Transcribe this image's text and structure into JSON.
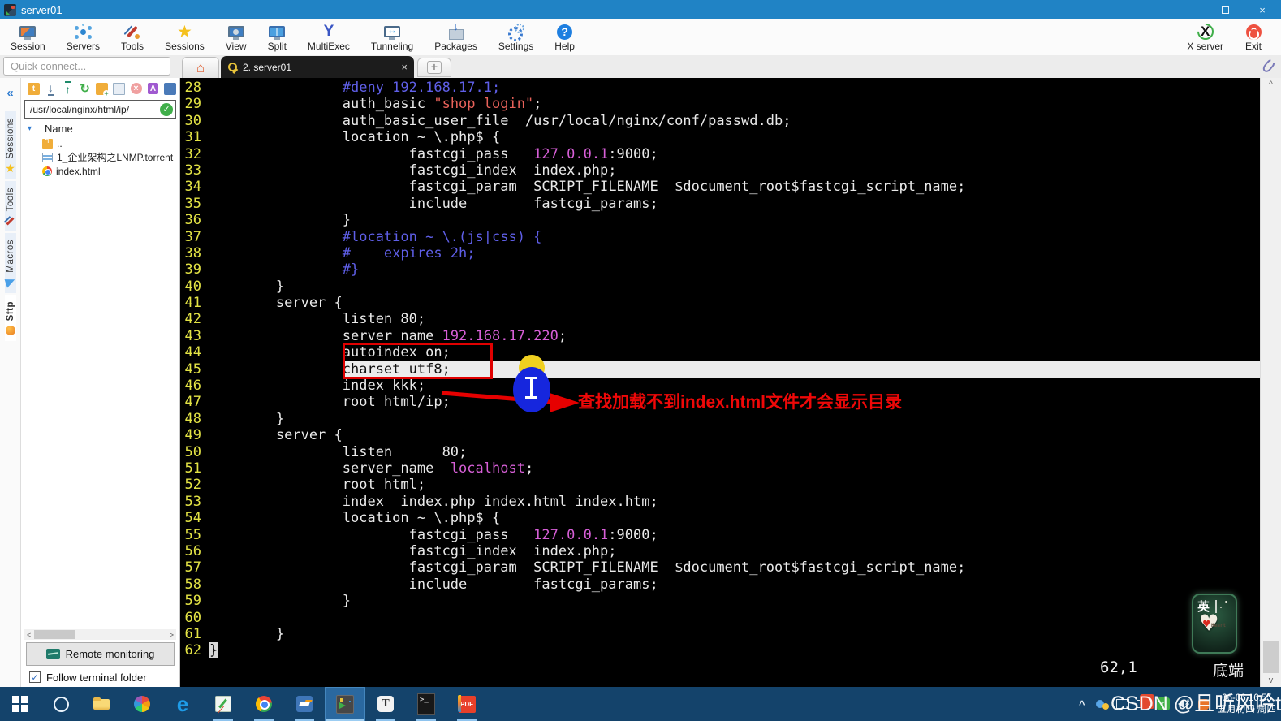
{
  "window": {
    "title": "server01"
  },
  "toolbar": {
    "buttons": [
      {
        "label": "Session",
        "icon": "session-icon"
      },
      {
        "label": "Servers",
        "icon": "servers-icon"
      },
      {
        "label": "Tools",
        "icon": "tools-icon"
      },
      {
        "label": "Sessions",
        "icon": "sessions-star-icon"
      },
      {
        "label": "View",
        "icon": "view-icon"
      },
      {
        "label": "Split",
        "icon": "split-icon"
      },
      {
        "label": "MultiExec",
        "icon": "multiexec-icon"
      },
      {
        "label": "Tunneling",
        "icon": "tunneling-icon"
      },
      {
        "label": "Packages",
        "icon": "packages-icon"
      },
      {
        "label": "Settings",
        "icon": "settings-icon"
      },
      {
        "label": "Help",
        "icon": "help-icon"
      }
    ],
    "right_buttons": [
      {
        "label": "X server",
        "icon": "xserver-icon"
      },
      {
        "label": "Exit",
        "icon": "exit-icon"
      }
    ]
  },
  "quick_connect": {
    "placeholder": "Quick connect..."
  },
  "tabs": {
    "active_label": "2. server01",
    "close_glyph": "×"
  },
  "sidebar": {
    "tabs": [
      {
        "label": "Sessions",
        "icon": "star-icon",
        "active": false
      },
      {
        "label": "Tools",
        "icon": "vtools-icon",
        "active": false
      },
      {
        "label": "Macros",
        "icon": "macro-plane-icon",
        "active": false
      },
      {
        "label": "Sftp",
        "icon": "sftp-ball-icon",
        "active": true
      }
    ],
    "sftp_icons": [
      "folder-up-icon",
      "download-icon",
      "upload-icon",
      "refresh-icon",
      "new-folder-icon",
      "new-file-icon",
      "delete-icon",
      "rename-icon",
      "sync-icon"
    ],
    "path": "/usr/local/nginx/html/ip/",
    "name_header": "Name",
    "files": [
      {
        "name": "..",
        "icon": "folder-up"
      },
      {
        "name": "1_企业架构之LNMP.torrent",
        "icon": "torrent-file"
      },
      {
        "name": "index.html",
        "icon": "chrome-file"
      }
    ],
    "remote_monitoring_label": "Remote monitoring",
    "follow_label": "Follow terminal folder"
  },
  "terminal": {
    "colors": {
      "comment": "#5f5fe8",
      "string": "#e8625a",
      "ip": "#d75fd7",
      "line_number": "#e3e345"
    },
    "highlight_line": 45,
    "boxed_lines": [
      44,
      45
    ],
    "annotation": "查找加载不到index.html文件才会显示目录",
    "status": {
      "position": "62,1",
      "scroll": "底端"
    },
    "lines": [
      {
        "n": 28,
        "s": [
          {
            "t": "                #deny 192.168.17.1;",
            "c": "comment"
          }
        ]
      },
      {
        "n": 29,
        "s": [
          {
            "t": "                auth_basic ",
            "c": "code"
          },
          {
            "t": "\"shop login\"",
            "c": "string"
          },
          {
            "t": ";",
            "c": "code"
          }
        ]
      },
      {
        "n": 30,
        "s": [
          {
            "t": "                auth_basic_user_file  /usr/local/nginx/conf/passwd.db;",
            "c": "code"
          }
        ]
      },
      {
        "n": 31,
        "s": [
          {
            "t": "                location ~ \\.php$ {",
            "c": "code"
          }
        ]
      },
      {
        "n": 32,
        "s": [
          {
            "t": "                        fastcgi_pass   ",
            "c": "code"
          },
          {
            "t": "127.0.0.1",
            "c": "ip"
          },
          {
            "t": ":9000;",
            "c": "code"
          }
        ]
      },
      {
        "n": 33,
        "s": [
          {
            "t": "                        fastcgi_index  index.php;",
            "c": "code"
          }
        ]
      },
      {
        "n": 34,
        "s": [
          {
            "t": "                        fastcgi_param  SCRIPT_FILENAME  $document_root$fastcgi_script_name;",
            "c": "code"
          }
        ]
      },
      {
        "n": 35,
        "s": [
          {
            "t": "                        include        fastcgi_params;",
            "c": "code"
          }
        ]
      },
      {
        "n": 36,
        "s": [
          {
            "t": "                }",
            "c": "code"
          }
        ]
      },
      {
        "n": 37,
        "s": [
          {
            "t": "                #location ~ \\.(js|css) {",
            "c": "comment"
          }
        ]
      },
      {
        "n": 38,
        "s": [
          {
            "t": "                #    expires 2h;",
            "c": "comment"
          }
        ]
      },
      {
        "n": 39,
        "s": [
          {
            "t": "                #}",
            "c": "comment"
          }
        ]
      },
      {
        "n": 40,
        "s": [
          {
            "t": "        }",
            "c": "code"
          }
        ]
      },
      {
        "n": 41,
        "s": [
          {
            "t": "        server {",
            "c": "code"
          }
        ]
      },
      {
        "n": 42,
        "s": [
          {
            "t": "                listen 80;",
            "c": "code"
          }
        ]
      },
      {
        "n": 43,
        "s": [
          {
            "t": "                server_name ",
            "c": "code"
          },
          {
            "t": "192.168.17.220",
            "c": "ip"
          },
          {
            "t": ";",
            "c": "code"
          }
        ]
      },
      {
        "n": 44,
        "s": [
          {
            "t": "                autoindex on;",
            "c": "code"
          }
        ]
      },
      {
        "n": 45,
        "hl": true,
        "s": [
          {
            "t": "                charset utf8;",
            "c": "code"
          }
        ]
      },
      {
        "n": 46,
        "s": [
          {
            "t": "                index kkk;",
            "c": "code"
          }
        ]
      },
      {
        "n": 47,
        "s": [
          {
            "t": "                root html/ip;",
            "c": "code"
          }
        ]
      },
      {
        "n": 48,
        "s": [
          {
            "t": "        }",
            "c": "code"
          }
        ]
      },
      {
        "n": 49,
        "s": [
          {
            "t": "        server {",
            "c": "code"
          }
        ]
      },
      {
        "n": 50,
        "s": [
          {
            "t": "                listen      80;",
            "c": "code"
          }
        ]
      },
      {
        "n": 51,
        "s": [
          {
            "t": "                server_name  ",
            "c": "code"
          },
          {
            "t": "localhost",
            "c": "ip"
          },
          {
            "t": ";",
            "c": "code"
          }
        ]
      },
      {
        "n": 52,
        "s": [
          {
            "t": "                root html;",
            "c": "code"
          }
        ]
      },
      {
        "n": 53,
        "s": [
          {
            "t": "                index  index.php index.html index.htm;",
            "c": "code"
          }
        ]
      },
      {
        "n": 54,
        "s": [
          {
            "t": "                location ~ \\.php$ {",
            "c": "code"
          }
        ]
      },
      {
        "n": 55,
        "s": [
          {
            "t": "                        fastcgi_pass   ",
            "c": "code"
          },
          {
            "t": "127.0.0.1",
            "c": "ip"
          },
          {
            "t": ":9000;",
            "c": "code"
          }
        ]
      },
      {
        "n": 56,
        "s": [
          {
            "t": "                        fastcgi_index  index.php;",
            "c": "code"
          }
        ]
      },
      {
        "n": 57,
        "s": [
          {
            "t": "                        fastcgi_param  SCRIPT_FILENAME  $document_root$fastcgi_script_name;",
            "c": "code"
          }
        ]
      },
      {
        "n": 58,
        "s": [
          {
            "t": "                        include        fastcgi_params;",
            "c": "code"
          }
        ]
      },
      {
        "n": 59,
        "s": [
          {
            "t": "                }",
            "c": "code"
          }
        ]
      },
      {
        "n": 60,
        "s": [
          {
            "t": "",
            "c": "code"
          }
        ]
      },
      {
        "n": 61,
        "s": [
          {
            "t": "        }",
            "c": "code"
          }
        ]
      },
      {
        "n": 62,
        "s": [
          {
            "t": "}",
            "c": "cursor"
          }
        ]
      }
    ]
  },
  "sticker": {
    "char": "英",
    "heart_text": "Heart",
    "heart_glyph": "♥"
  },
  "taskbar": {
    "items": [
      {
        "name": "start",
        "icon": "ai-start",
        "running": false,
        "active": false
      },
      {
        "name": "cortana",
        "icon": "ai-cortana",
        "running": false,
        "active": false
      },
      {
        "name": "explorer",
        "icon": "ai-explorer",
        "running": false,
        "active": false
      },
      {
        "name": "media",
        "icon": "ai-media",
        "running": false,
        "active": false
      },
      {
        "name": "edge",
        "icon": "ai-edge",
        "running": false,
        "active": false
      },
      {
        "name": "editor",
        "icon": "ai-editor",
        "running": true,
        "active": false
      },
      {
        "name": "chrome",
        "icon": "ai-chrome",
        "running": true,
        "active": false
      },
      {
        "name": "vmware",
        "icon": "ai-vmware",
        "running": true,
        "active": false
      },
      {
        "name": "mobaxterm",
        "icon": "ai-moba",
        "running": true,
        "active": true
      },
      {
        "name": "typora",
        "icon": "ai-typora",
        "running": true,
        "active": false
      },
      {
        "name": "cmd",
        "icon": "ai-cmd",
        "running": true,
        "active": false
      },
      {
        "name": "pdf",
        "icon": "ai-pdf",
        "running": true,
        "active": false
      }
    ],
    "tray_icons": [
      "chevron-up-icon",
      "cloud-icon",
      "display-icon",
      "battery-icon",
      "updater-icon",
      "mute-icon",
      "orange-dot-icon"
    ],
    "clock_line1": "06-06 16:55",
    "clock_line2": "五月初四 周四",
    "watermark": "CSDN @且听风吟tmj"
  }
}
